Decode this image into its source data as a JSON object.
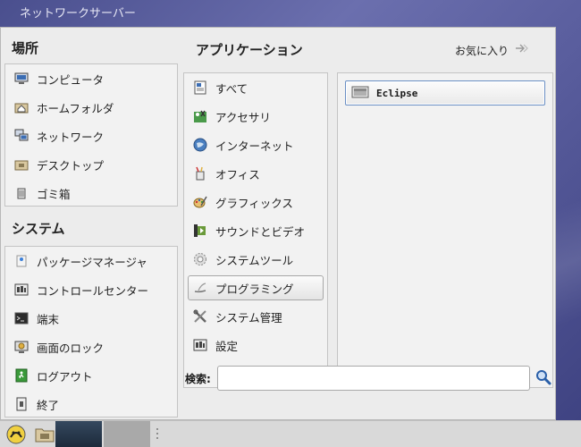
{
  "window_title": "ネットワークサーバー",
  "places": {
    "title": "場所",
    "items": [
      {
        "label": "コンピュータ",
        "icon": "computer-icon"
      },
      {
        "label": "ホームフォルダ",
        "icon": "home-folder-icon"
      },
      {
        "label": "ネットワーク",
        "icon": "network-icon"
      },
      {
        "label": "デスクトップ",
        "icon": "desktop-folder-icon"
      },
      {
        "label": "ゴミ箱",
        "icon": "trash-icon"
      }
    ]
  },
  "system": {
    "title": "システム",
    "items": [
      {
        "label": "パッケージマネージャ",
        "icon": "package-icon"
      },
      {
        "label": "コントロールセンター",
        "icon": "control-center-icon"
      },
      {
        "label": "端末",
        "icon": "terminal-icon"
      },
      {
        "label": "画面のロック",
        "icon": "lock-screen-icon"
      },
      {
        "label": "ログアウト",
        "icon": "logout-icon"
      },
      {
        "label": "終了",
        "icon": "shutdown-icon"
      }
    ]
  },
  "applications": {
    "title": "アプリケーション",
    "favorites_label": "お気に入り",
    "categories": [
      {
        "label": "すべて",
        "icon": "all-icon"
      },
      {
        "label": "アクセサリ",
        "icon": "accessories-icon"
      },
      {
        "label": "インターネット",
        "icon": "internet-icon"
      },
      {
        "label": "オフィス",
        "icon": "office-icon"
      },
      {
        "label": "グラフィックス",
        "icon": "graphics-icon"
      },
      {
        "label": "サウンドとビデオ",
        "icon": "sound-video-icon"
      },
      {
        "label": "システムツール",
        "icon": "system-tools-icon"
      },
      {
        "label": "プログラミング",
        "icon": "programming-icon",
        "selected": true
      },
      {
        "label": "システム管理",
        "icon": "system-admin-icon"
      },
      {
        "label": "設定",
        "icon": "settings-icon"
      }
    ],
    "apps": [
      {
        "label": "Eclipse",
        "icon": "eclipse-icon"
      }
    ]
  },
  "search": {
    "label": "検索:",
    "value": ""
  },
  "colors": {
    "accent_border": "#6a8fc4",
    "desktop_bg": "#5a5e9e"
  }
}
